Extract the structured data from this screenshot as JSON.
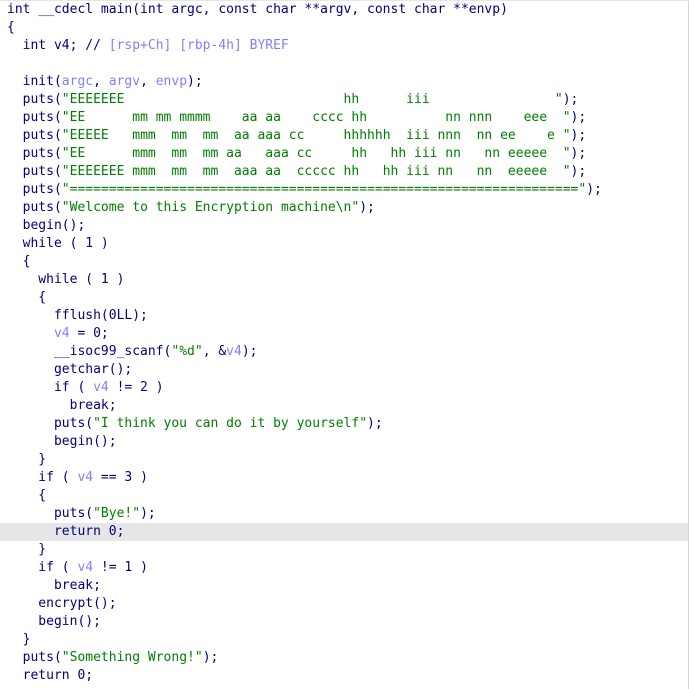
{
  "code": [
    {
      "highlight": false,
      "tokens": [
        {
          "c": "id",
          "t": "int __cdecl main(int argc, const char **argv, const char **envp)"
        }
      ]
    },
    {
      "highlight": false,
      "tokens": [
        {
          "c": "id",
          "t": "{"
        }
      ]
    },
    {
      "highlight": false,
      "tokens": [
        {
          "c": "id",
          "t": "  int v4; // "
        },
        {
          "c": "cmt",
          "t": "[rsp+Ch] [rbp-4h] BYREF"
        }
      ]
    },
    {
      "highlight": false,
      "tokens": [
        {
          "c": "id",
          "t": ""
        }
      ]
    },
    {
      "highlight": false,
      "tokens": [
        {
          "c": "id",
          "t": "  init("
        },
        {
          "c": "var",
          "t": "argc"
        },
        {
          "c": "id",
          "t": ", "
        },
        {
          "c": "var",
          "t": "argv"
        },
        {
          "c": "id",
          "t": ", "
        },
        {
          "c": "var",
          "t": "envp"
        },
        {
          "c": "id",
          "t": ");"
        }
      ]
    },
    {
      "highlight": false,
      "tokens": [
        {
          "c": "id",
          "t": "  puts("
        },
        {
          "c": "str",
          "t": "\"EEEEEEE                            hh      iii                \""
        },
        {
          "c": "id",
          "t": ");"
        }
      ]
    },
    {
      "highlight": false,
      "tokens": [
        {
          "c": "id",
          "t": "  puts("
        },
        {
          "c": "str",
          "t": "\"EE      mm mm mmmm    aa aa    cccc hh          nn nnn    eee  \""
        },
        {
          "c": "id",
          "t": ");"
        }
      ]
    },
    {
      "highlight": false,
      "tokens": [
        {
          "c": "id",
          "t": "  puts("
        },
        {
          "c": "str",
          "t": "\"EEEEE   mmm  mm  mm  aa aaa cc     hhhhhh  iii nnn  nn ee    e \""
        },
        {
          "c": "id",
          "t": ");"
        }
      ]
    },
    {
      "highlight": false,
      "tokens": [
        {
          "c": "id",
          "t": "  puts("
        },
        {
          "c": "str",
          "t": "\"EE      mmm  mm  mm aa   aaa cc     hh   hh iii nn   nn eeeee  \""
        },
        {
          "c": "id",
          "t": ");"
        }
      ]
    },
    {
      "highlight": false,
      "tokens": [
        {
          "c": "id",
          "t": "  puts("
        },
        {
          "c": "str",
          "t": "\"EEEEEEE mmm  mm  mm  aaa aa  ccccc hh   hh iii nn   nn  eeeee  \""
        },
        {
          "c": "id",
          "t": ");"
        }
      ]
    },
    {
      "highlight": false,
      "tokens": [
        {
          "c": "id",
          "t": "  puts("
        },
        {
          "c": "str",
          "t": "\"=================================================================\""
        },
        {
          "c": "id",
          "t": ");"
        }
      ]
    },
    {
      "highlight": false,
      "tokens": [
        {
          "c": "id",
          "t": "  puts("
        },
        {
          "c": "str",
          "t": "\"Welcome to this Encryption machine\\n\""
        },
        {
          "c": "id",
          "t": ");"
        }
      ]
    },
    {
      "highlight": false,
      "tokens": [
        {
          "c": "id",
          "t": "  begin();"
        }
      ]
    },
    {
      "highlight": false,
      "tokens": [
        {
          "c": "id",
          "t": "  while ( 1 )"
        }
      ]
    },
    {
      "highlight": false,
      "tokens": [
        {
          "c": "id",
          "t": "  {"
        }
      ]
    },
    {
      "highlight": false,
      "tokens": [
        {
          "c": "id",
          "t": "    while ( 1 )"
        }
      ]
    },
    {
      "highlight": false,
      "tokens": [
        {
          "c": "id",
          "t": "    {"
        }
      ]
    },
    {
      "highlight": false,
      "tokens": [
        {
          "c": "id",
          "t": "      fflush(0LL);"
        }
      ]
    },
    {
      "highlight": false,
      "tokens": [
        {
          "c": "id",
          "t": "      "
        },
        {
          "c": "var",
          "t": "v4"
        },
        {
          "c": "id",
          "t": " = 0;"
        }
      ]
    },
    {
      "highlight": false,
      "tokens": [
        {
          "c": "id",
          "t": "      __isoc99_scanf("
        },
        {
          "c": "str",
          "t": "\"%d\""
        },
        {
          "c": "id",
          "t": ", &"
        },
        {
          "c": "var",
          "t": "v4"
        },
        {
          "c": "id",
          "t": ");"
        }
      ]
    },
    {
      "highlight": false,
      "tokens": [
        {
          "c": "id",
          "t": "      getchar();"
        }
      ]
    },
    {
      "highlight": false,
      "tokens": [
        {
          "c": "id",
          "t": "      if ( "
        },
        {
          "c": "var",
          "t": "v4"
        },
        {
          "c": "id",
          "t": " != 2 )"
        }
      ]
    },
    {
      "highlight": false,
      "tokens": [
        {
          "c": "id",
          "t": "        break;"
        }
      ]
    },
    {
      "highlight": false,
      "tokens": [
        {
          "c": "id",
          "t": "      puts("
        },
        {
          "c": "str",
          "t": "\"I think you can do it by yourself\""
        },
        {
          "c": "id",
          "t": ");"
        }
      ]
    },
    {
      "highlight": false,
      "tokens": [
        {
          "c": "id",
          "t": "      begin();"
        }
      ]
    },
    {
      "highlight": false,
      "tokens": [
        {
          "c": "id",
          "t": "    }"
        }
      ]
    },
    {
      "highlight": false,
      "tokens": [
        {
          "c": "id",
          "t": "    if ( "
        },
        {
          "c": "var",
          "t": "v4"
        },
        {
          "c": "id",
          "t": " == 3 )"
        }
      ]
    },
    {
      "highlight": false,
      "tokens": [
        {
          "c": "id",
          "t": "    {"
        }
      ]
    },
    {
      "highlight": false,
      "tokens": [
        {
          "c": "id",
          "t": "      puts("
        },
        {
          "c": "str",
          "t": "\"Bye!\""
        },
        {
          "c": "id",
          "t": ");"
        }
      ]
    },
    {
      "highlight": true,
      "tokens": [
        {
          "c": "id",
          "t": "      return 0;"
        }
      ]
    },
    {
      "highlight": false,
      "tokens": [
        {
          "c": "id",
          "t": "    }"
        }
      ]
    },
    {
      "highlight": false,
      "tokens": [
        {
          "c": "id",
          "t": "    if ( "
        },
        {
          "c": "var",
          "t": "v4"
        },
        {
          "c": "id",
          "t": " != 1 )"
        }
      ]
    },
    {
      "highlight": false,
      "tokens": [
        {
          "c": "id",
          "t": "      break;"
        }
      ]
    },
    {
      "highlight": false,
      "tokens": [
        {
          "c": "id",
          "t": "    encrypt();"
        }
      ]
    },
    {
      "highlight": false,
      "tokens": [
        {
          "c": "id",
          "t": "    begin();"
        }
      ]
    },
    {
      "highlight": false,
      "tokens": [
        {
          "c": "id",
          "t": "  }"
        }
      ]
    },
    {
      "highlight": false,
      "tokens": [
        {
          "c": "id",
          "t": "  puts("
        },
        {
          "c": "str",
          "t": "\"Something Wrong!\""
        },
        {
          "c": "id",
          "t": ");"
        }
      ]
    },
    {
      "highlight": false,
      "tokens": [
        {
          "c": "id",
          "t": "  return 0;"
        }
      ]
    }
  ],
  "colors": {
    "identifier": "#000080",
    "string": "#008000",
    "variable": "#8080ff",
    "comment": "#8080ff",
    "highlight_line": "#e6e6e6",
    "background": "#ffffff"
  }
}
